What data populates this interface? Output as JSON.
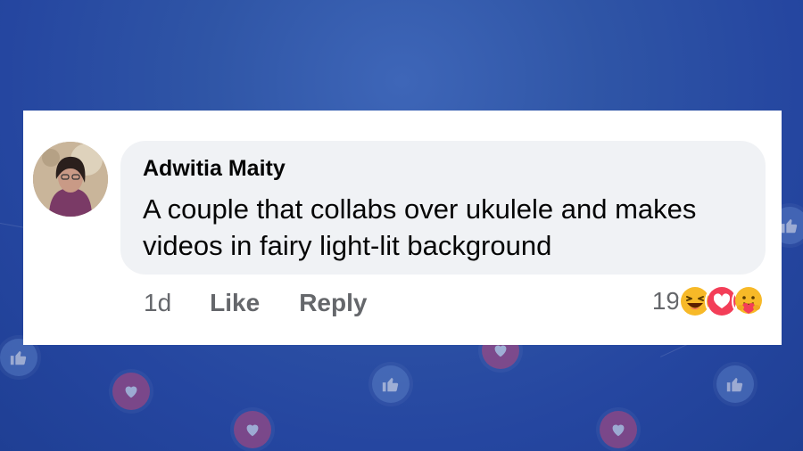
{
  "comment": {
    "author": "Adwitia Maity",
    "text": "A couple that collabs over ukulele and makes videos in fairy light-lit background",
    "time": "1d",
    "like_label": "Like",
    "reply_label": "Reply",
    "reaction_count": "19",
    "reactions": [
      "haha-icon",
      "love-icon",
      "care-icon"
    ]
  },
  "colors": {
    "background": "#2f55a6",
    "bubble": "#f0f2f5",
    "meta_text": "#65676b"
  }
}
